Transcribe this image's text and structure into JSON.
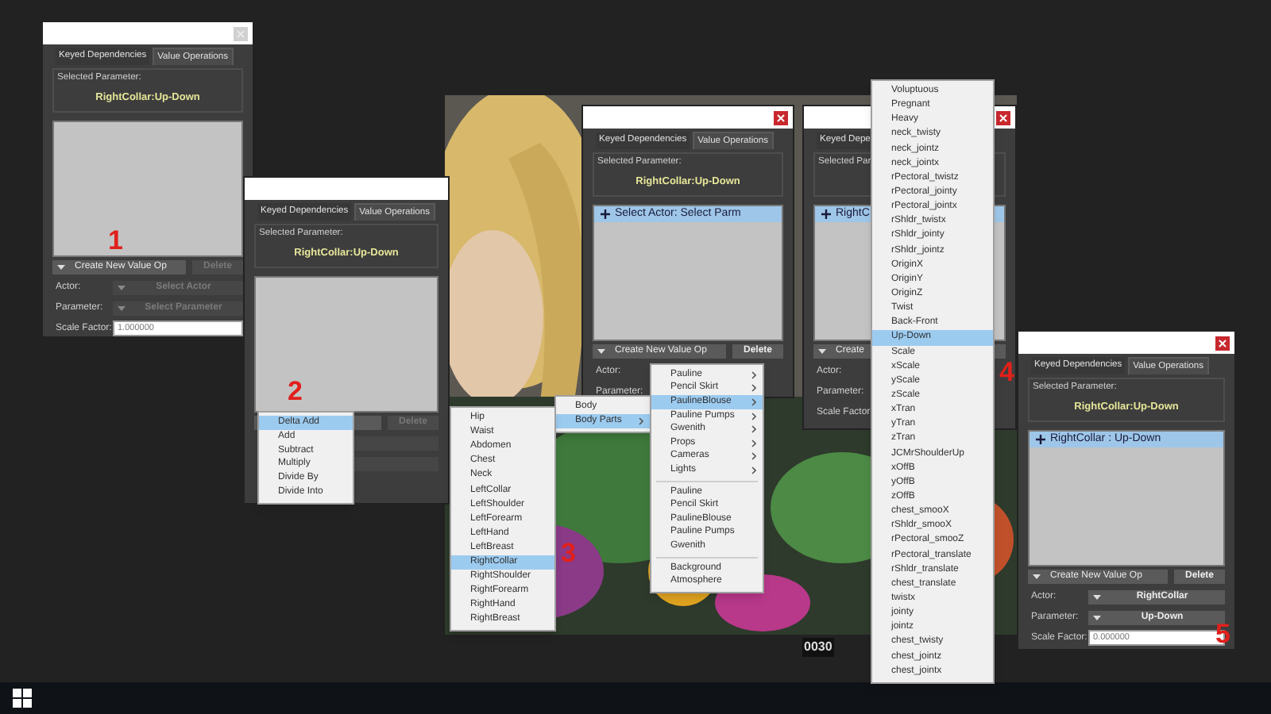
{
  "steps": [
    {
      "number": "1",
      "dialog": {
        "close_active": false,
        "tabs": [
          {
            "label": "Keyed Dependencies",
            "selected": false
          },
          {
            "label": "Value Operations",
            "selected": true
          }
        ],
        "selected_parameter_label": "Selected Parameter:",
        "selected_parameter": "RightCollar:Up-Down",
        "create_button": {
          "label": "Create New Value Op",
          "disabled": false
        },
        "delete_button": {
          "label": "Delete",
          "disabled": true
        },
        "actor": {
          "label": "Actor:",
          "value": "Select Actor",
          "disabled": true
        },
        "parameter": {
          "label": "Parameter:",
          "value": "Select Parameter",
          "disabled": true
        },
        "scale_factor": {
          "label": "Scale Factor:",
          "value": "1.000000"
        }
      }
    },
    {
      "number": "2",
      "dialog": {
        "tabs": [
          {
            "label": "Keyed Dependencies",
            "selected": false
          },
          {
            "label": "Value Operations",
            "selected": true
          }
        ],
        "selected_parameter_label": "Selected Parameter:",
        "selected_parameter": "RightCollar:Up-Down",
        "create_button": {
          "disabled": false
        },
        "delete_button": {
          "label": "Delete",
          "disabled": true
        },
        "actor": {
          "disabled": true
        },
        "parameter": {
          "disabled": true
        }
      },
      "menus": [
        {
          "items": [
            {
              "kind": "item",
              "label": "Delta Add",
              "selected": true,
              "has_submenu": false
            },
            {
              "kind": "item",
              "label": "Add",
              "selected": false,
              "has_submenu": false
            },
            {
              "kind": "item",
              "label": "Subtract",
              "selected": false,
              "has_submenu": false
            },
            {
              "kind": "item",
              "label": "Multiply",
              "selected": false,
              "has_submenu": false
            },
            {
              "kind": "item",
              "label": "Divide By",
              "selected": false,
              "has_submenu": false
            },
            {
              "kind": "item",
              "label": "Divide Into",
              "selected": false,
              "has_submenu": false
            }
          ]
        }
      ]
    },
    {
      "number": "3",
      "dialog": {
        "close_active": true,
        "tabs": [
          {
            "label": "Keyed Dependencies",
            "selected": false
          },
          {
            "label": "Value Operations",
            "selected": true
          }
        ],
        "selected_parameter_label": "Selected Parameter:",
        "selected_parameter": "RightCollar:Up-Down",
        "ops": [
          {
            "label": "Select Actor: Select Parm",
            "selected": true
          }
        ],
        "create_button": {
          "label": "Create New Value Op",
          "disabled": false
        },
        "delete_button": {
          "label": "Delete",
          "disabled": false
        },
        "actor": {
          "label": "Actor:"
        },
        "parameter": {
          "label": "Parameter:"
        }
      },
      "menus": [
        {
          "items": [
            {
              "kind": "item",
              "label": "Body",
              "selected": false,
              "has_submenu": false
            },
            {
              "kind": "item",
              "label": "Body Parts",
              "selected": true,
              "has_submenu": true
            }
          ]
        },
        {
          "items": [
            {
              "kind": "item",
              "label": "Pauline",
              "selected": false,
              "has_submenu": true
            },
            {
              "kind": "item",
              "label": "Pencil Skirt",
              "selected": false,
              "has_submenu": true
            },
            {
              "kind": "item",
              "label": "PaulineBlouse",
              "selected": true,
              "has_submenu": true
            },
            {
              "kind": "item",
              "label": "Pauline Pumps",
              "selected": false,
              "has_submenu": true
            },
            {
              "kind": "item",
              "label": "Gwenith",
              "selected": false,
              "has_submenu": true
            },
            {
              "kind": "item",
              "label": "Props",
              "selected": false,
              "has_submenu": true
            },
            {
              "kind": "item",
              "label": "Cameras",
              "selected": false,
              "has_submenu": true
            },
            {
              "kind": "item",
              "label": "Lights",
              "selected": false,
              "has_submenu": true
            },
            {
              "kind": "separator"
            },
            {
              "kind": "item",
              "label": "Pauline",
              "selected": false,
              "has_submenu": false
            },
            {
              "kind": "item",
              "label": "Pencil Skirt",
              "selected": false,
              "has_submenu": false
            },
            {
              "kind": "item",
              "label": "PaulineBlouse",
              "selected": false,
              "has_submenu": false
            },
            {
              "kind": "item",
              "label": "Pauline Pumps",
              "selected": false,
              "has_submenu": false
            },
            {
              "kind": "item",
              "label": "Gwenith",
              "selected": false,
              "has_submenu": false
            },
            {
              "kind": "separator"
            },
            {
              "kind": "item",
              "label": "Background",
              "selected": false,
              "has_submenu": false
            },
            {
              "kind": "item",
              "label": "Atmosphere",
              "selected": false,
              "has_submenu": false
            }
          ]
        },
        {
          "items": [
            {
              "kind": "item",
              "label": "Hip",
              "selected": false,
              "has_submenu": false
            },
            {
              "kind": "item",
              "label": "Waist",
              "selected": false,
              "has_submenu": false
            },
            {
              "kind": "item",
              "label": "Abdomen",
              "selected": false,
              "has_submenu": false
            },
            {
              "kind": "item",
              "label": "Chest",
              "selected": false,
              "has_submenu": false
            },
            {
              "kind": "item",
              "label": "Neck",
              "selected": false,
              "has_submenu": false
            },
            {
              "kind": "item",
              "label": "LeftCollar",
              "selected": false,
              "has_submenu": false
            },
            {
              "kind": "item",
              "label": "LeftShoulder",
              "selected": false,
              "has_submenu": false
            },
            {
              "kind": "item",
              "label": "LeftForearm",
              "selected": false,
              "has_submenu": false
            },
            {
              "kind": "item",
              "label": "LeftHand",
              "selected": false,
              "has_submenu": false
            },
            {
              "kind": "item",
              "label": "LeftBreast",
              "selected": false,
              "has_submenu": false
            },
            {
              "kind": "item",
              "label": "RightCollar",
              "selected": true,
              "has_submenu": false
            },
            {
              "kind": "item",
              "label": "RightShoulder",
              "selected": false,
              "has_submenu": false
            },
            {
              "kind": "item",
              "label": "RightForearm",
              "selected": false,
              "has_submenu": false
            },
            {
              "kind": "item",
              "label": "RightHand",
              "selected": false,
              "has_submenu": false
            },
            {
              "kind": "item",
              "label": "RightBreast",
              "selected": false,
              "has_submenu": false
            }
          ]
        }
      ]
    },
    {
      "number": "4",
      "dialog": {
        "close_active": true,
        "tabs": [
          {
            "label": "Keyed Depe",
            "selected": false
          }
        ],
        "selected_parameter_label": "Selected Par",
        "ops": [
          {
            "label": "RightC",
            "selected": true
          }
        ],
        "create_button": {
          "label": "Create",
          "disabled": false
        },
        "actor": {
          "label": "Actor:"
        },
        "parameter": {
          "label": "Parameter:"
        },
        "scale_factor": {
          "label": "Scale Factor"
        }
      },
      "timeline_frame": "0030",
      "menus": [
        {
          "items": [
            {
              "kind": "item",
              "label": "Voluptuous",
              "selected": false,
              "has_submenu": false
            },
            {
              "kind": "item",
              "label": "Pregnant",
              "selected": false,
              "has_submenu": false
            },
            {
              "kind": "item",
              "label": "Heavy",
              "selected": false,
              "has_submenu": false
            },
            {
              "kind": "item",
              "label": "neck_twisty",
              "selected": false,
              "has_submenu": false
            },
            {
              "kind": "item",
              "label": "neck_jointz",
              "selected": false,
              "has_submenu": false
            },
            {
              "kind": "item",
              "label": "neck_jointx",
              "selected": false,
              "has_submenu": false
            },
            {
              "kind": "item",
              "label": "rPectoral_twistz",
              "selected": false,
              "has_submenu": false
            },
            {
              "kind": "item",
              "label": "rPectoral_jointy",
              "selected": false,
              "has_submenu": false
            },
            {
              "kind": "item",
              "label": "rPectoral_jointx",
              "selected": false,
              "has_submenu": false
            },
            {
              "kind": "item",
              "label": "rShldr_twistx",
              "selected": false,
              "has_submenu": false
            },
            {
              "kind": "item",
              "label": "rShldr_jointy",
              "selected": false,
              "has_submenu": false
            },
            {
              "kind": "item",
              "label": "rShldr_jointz",
              "selected": false,
              "has_submenu": false
            },
            {
              "kind": "item",
              "label": "OriginX",
              "selected": false,
              "has_submenu": false
            },
            {
              "kind": "item",
              "label": "OriginY",
              "selected": false,
              "has_submenu": false
            },
            {
              "kind": "item",
              "label": "OriginZ",
              "selected": false,
              "has_submenu": false
            },
            {
              "kind": "item",
              "label": "Twist",
              "selected": false,
              "has_submenu": false
            },
            {
              "kind": "item",
              "label": "Back-Front",
              "selected": false,
              "has_submenu": false
            },
            {
              "kind": "item",
              "label": "Up-Down",
              "selected": true,
              "has_submenu": false
            },
            {
              "kind": "item",
              "label": "Scale",
              "selected": false,
              "has_submenu": false
            },
            {
              "kind": "item",
              "label": "xScale",
              "selected": false,
              "has_submenu": false
            },
            {
              "kind": "item",
              "label": "yScale",
              "selected": false,
              "has_submenu": false
            },
            {
              "kind": "item",
              "label": "zScale",
              "selected": false,
              "has_submenu": false
            },
            {
              "kind": "item",
              "label": "xTran",
              "selected": false,
              "has_submenu": false
            },
            {
              "kind": "item",
              "label": "yTran",
              "selected": false,
              "has_submenu": false
            },
            {
              "kind": "item",
              "label": "zTran",
              "selected": false,
              "has_submenu": false
            },
            {
              "kind": "item",
              "label": "JCMrShoulderUp",
              "selected": false,
              "has_submenu": false
            },
            {
              "kind": "item",
              "label": "xOffB",
              "selected": false,
              "has_submenu": false
            },
            {
              "kind": "item",
              "label": "yOffB",
              "selected": false,
              "has_submenu": false
            },
            {
              "kind": "item",
              "label": "zOffB",
              "selected": false,
              "has_submenu": false
            },
            {
              "kind": "item",
              "label": "chest_smooX",
              "selected": false,
              "has_submenu": false
            },
            {
              "kind": "item",
              "label": "rShldr_smooX",
              "selected": false,
              "has_submenu": false
            },
            {
              "kind": "item",
              "label": "rPectoral_smooZ",
              "selected": false,
              "has_submenu": false
            },
            {
              "kind": "item",
              "label": "rPectoral_translate",
              "selected": false,
              "has_submenu": false
            },
            {
              "kind": "item",
              "label": "rShldr_translate",
              "selected": false,
              "has_submenu": false
            },
            {
              "kind": "item",
              "label": "chest_translate",
              "selected": false,
              "has_submenu": false
            },
            {
              "kind": "item",
              "label": "twistx",
              "selected": false,
              "has_submenu": false
            },
            {
              "kind": "item",
              "label": "jointy",
              "selected": false,
              "has_submenu": false
            },
            {
              "kind": "item",
              "label": "jointz",
              "selected": false,
              "has_submenu": false
            },
            {
              "kind": "item",
              "label": "chest_twisty",
              "selected": false,
              "has_submenu": false
            },
            {
              "kind": "item",
              "label": "chest_jointz",
              "selected": false,
              "has_submenu": false
            },
            {
              "kind": "item",
              "label": "chest_jointx",
              "selected": false,
              "has_submenu": false
            }
          ]
        }
      ]
    },
    {
      "number": "5",
      "dialog": {
        "close_active": true,
        "tabs": [
          {
            "label": "Keyed Dependencies",
            "selected": false
          },
          {
            "label": "Value Operations",
            "selected": true
          }
        ],
        "selected_parameter_label": "Selected Parameter:",
        "selected_parameter": "RightCollar:Up-Down",
        "ops": [
          {
            "label": "RightCollar : Up-Down",
            "selected": true
          }
        ],
        "create_button": {
          "label": "Create New Value Op",
          "disabled": false
        },
        "delete_button": {
          "label": "Delete",
          "disabled": false
        },
        "actor": {
          "label": "Actor:",
          "value": "RightCollar",
          "disabled": false
        },
        "parameter": {
          "label": "Parameter:",
          "value": "Up-Down",
          "disabled": false
        },
        "scale_factor": {
          "label": "Scale Factor:",
          "value": "0.000000"
        }
      }
    }
  ]
}
